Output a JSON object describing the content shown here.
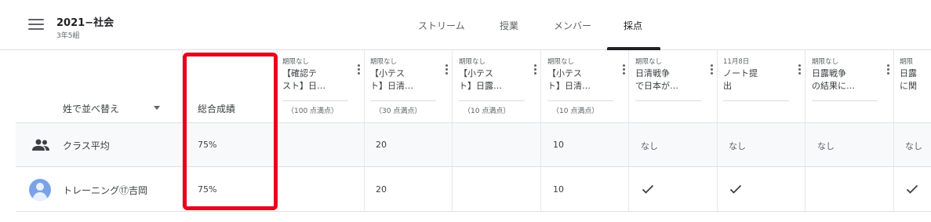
{
  "header": {
    "class_name": "2021−社会",
    "section": "3年5組",
    "tabs": [
      "ストリーム",
      "授業",
      "メンバー",
      "採点"
    ],
    "active_tab": "採点"
  },
  "grid": {
    "sort_label": "姓で並べ替え",
    "total_header": "総合成績",
    "columns": [
      {
        "due": "期限なし",
        "title": "【確認テ\nスト】日…",
        "points": "（100 点満点）"
      },
      {
        "due": "期限なし",
        "title": "【小テス\nト】日清…",
        "points": "（30 点満点）"
      },
      {
        "due": "期限なし",
        "title": "【小テス\nト】日露…",
        "points": "（10 点満点）"
      },
      {
        "due": "期限なし",
        "title": "【小テス\nト】日清…",
        "points": "（10 点満点）"
      },
      {
        "due": "期限なし",
        "title": "日清戦争\nで日本が…",
        "points": ""
      },
      {
        "due": "11月8日",
        "title": "ノート提\n出",
        "points": ""
      },
      {
        "due": "期限なし",
        "title": "日露戦争\nの結果に…",
        "points": ""
      },
      {
        "due": "期限",
        "title": "日露\nに関",
        "points": ""
      }
    ],
    "rows": [
      {
        "name": "クラス平均",
        "icon": "people-icon",
        "total": "75%",
        "cells": [
          "",
          "20",
          "",
          "10",
          "なし",
          "なし",
          "なし",
          "なし"
        ]
      },
      {
        "name": "トレーニング⑰吉岡",
        "icon": "avatar",
        "total": "75%",
        "cells": [
          "",
          "20",
          "",
          "10",
          "✓",
          "✓",
          "",
          "✓"
        ]
      }
    ]
  },
  "colors": {
    "highlight": "#e8001c",
    "avatar": "#7aa2e8",
    "active_tab_underline": "#202124"
  }
}
